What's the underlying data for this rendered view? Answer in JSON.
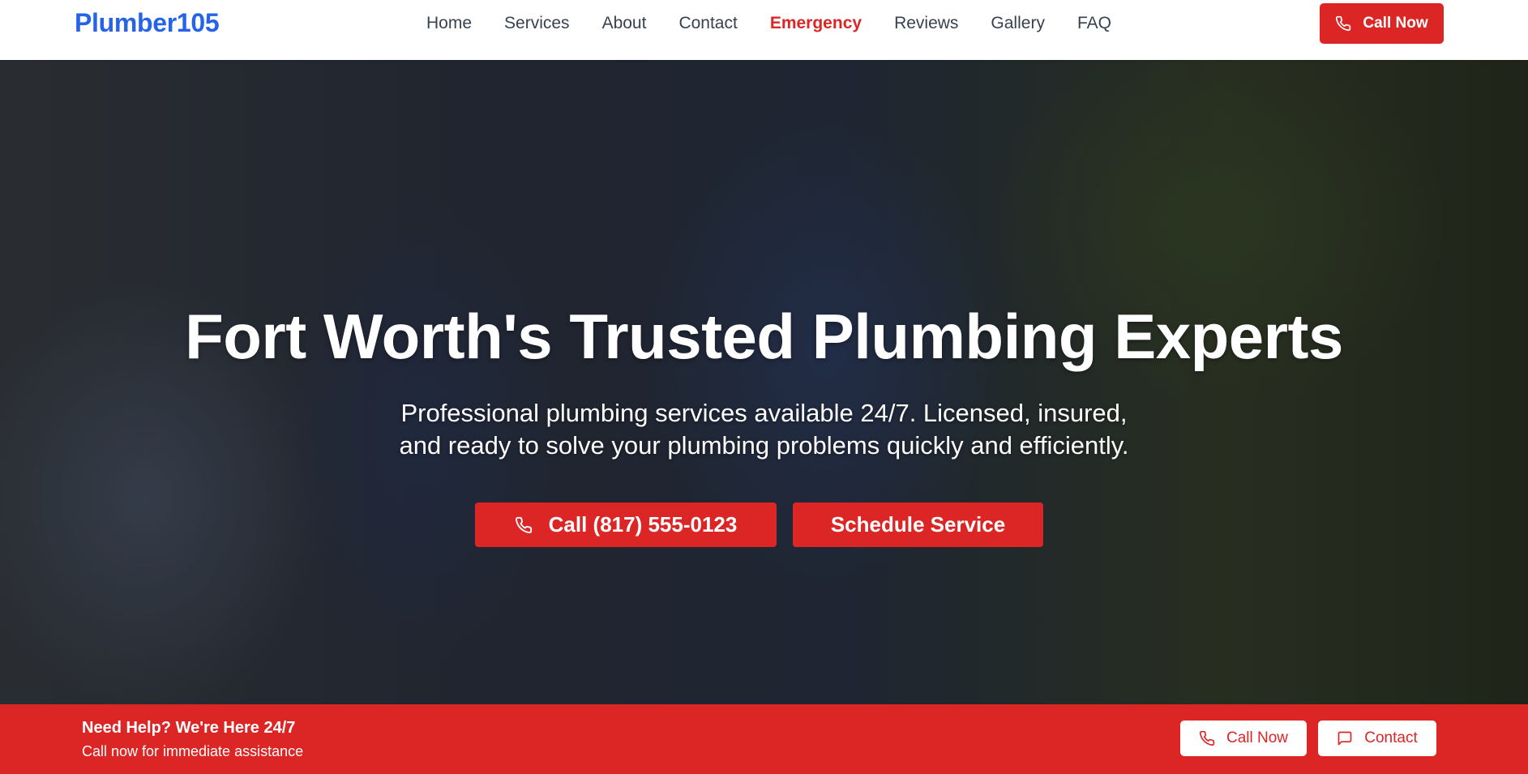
{
  "header": {
    "logo": "Plumber105",
    "nav": [
      "Home",
      "Services",
      "About",
      "Contact",
      "Emergency",
      "Reviews",
      "Gallery",
      "FAQ"
    ],
    "call_label": "Call Now"
  },
  "hero": {
    "title": "Fort Worth's Trusted Plumbing Experts",
    "subtitle_line1": "Professional plumbing services available 24/7. Licensed, insured,",
    "subtitle_line2": "and ready to solve your plumbing problems quickly and efficiently.",
    "call_button": "Call (817) 555-0123",
    "schedule_button": "Schedule Service"
  },
  "bottom_bar": {
    "title": "Need Help? We're Here 24/7",
    "subtitle": "Call now for immediate assistance",
    "call_label": "Call Now",
    "contact_label": "Contact"
  },
  "colors": {
    "accent": "#dc2626",
    "logo": "#2563eb",
    "nav_text": "#374151"
  },
  "icons": [
    "phone-icon",
    "message-icon"
  ]
}
